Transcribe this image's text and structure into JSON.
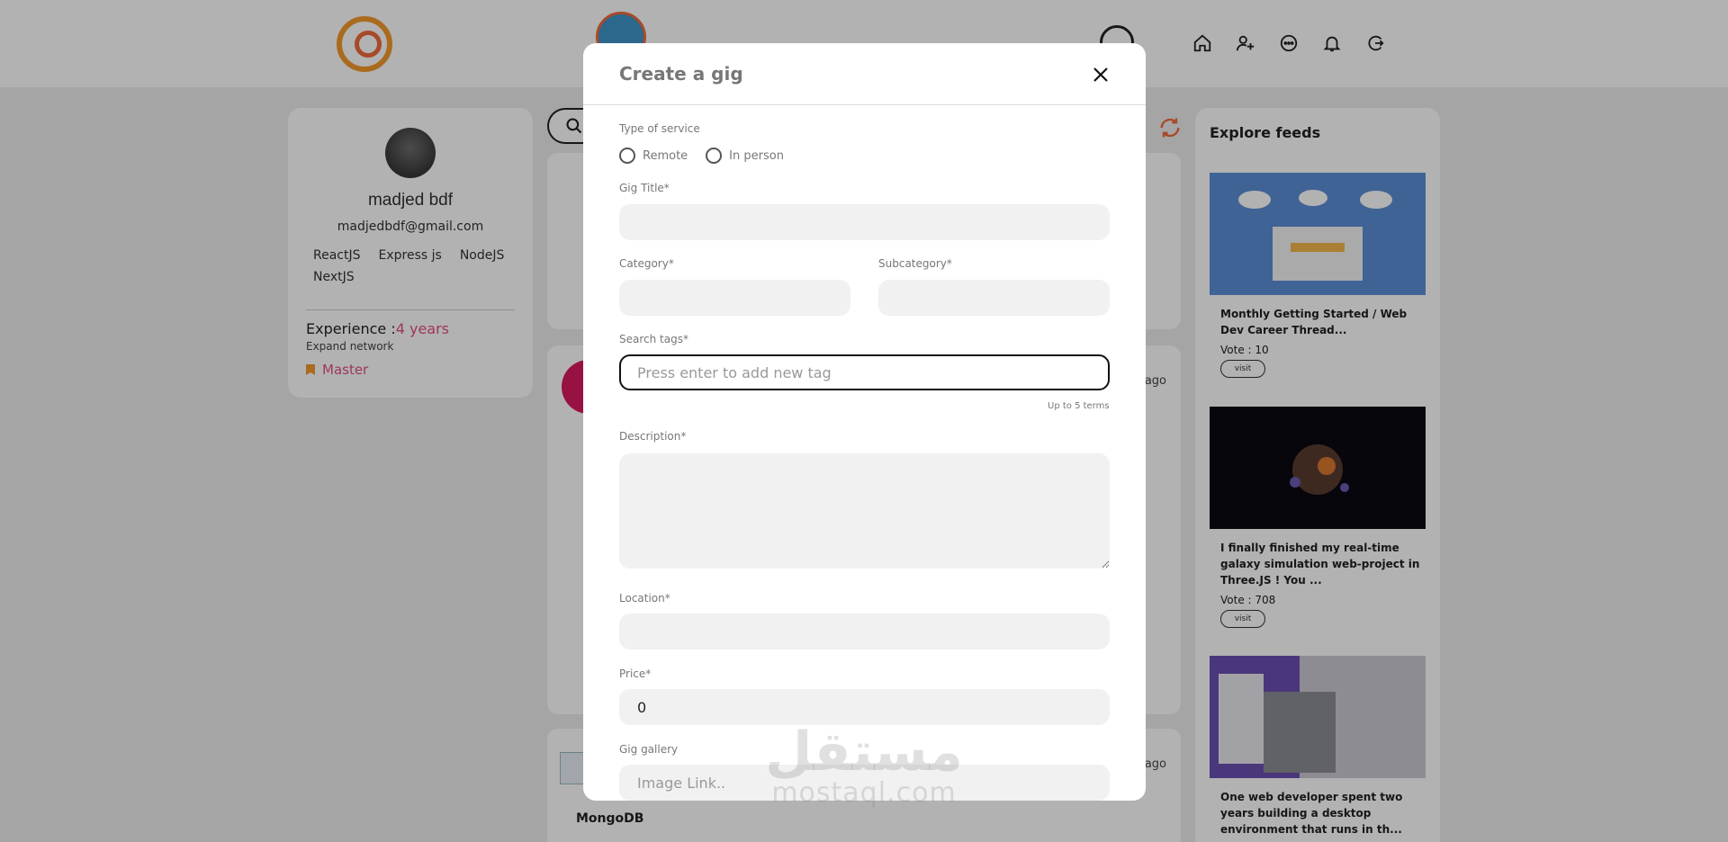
{
  "profile": {
    "name": "madjed bdf",
    "email": "madjedbdf@gmail.com",
    "skills": [
      "ReactJS",
      "Express js",
      "NodeJS",
      "NextJS"
    ],
    "experience_label": "Experience :",
    "experience_value": "4 years",
    "expand": "Expand network",
    "badge": "Master"
  },
  "feed": {
    "post_ago": "ago",
    "post2_title": "MongoDB"
  },
  "explore": {
    "title": "Explore feeds",
    "items": [
      {
        "title": "Monthly Getting Started / Web Dev Career Thread...",
        "vote": "Vote : 10",
        "visit": "visit"
      },
      {
        "title": "I finally finished my real-time galaxy simulation web-project in Three.JS ! You ...",
        "vote": "Vote : 708",
        "visit": "visit"
      },
      {
        "title": "One web developer spent two years building a desktop environment that runs in th...",
        "vote": "",
        "visit": ""
      }
    ]
  },
  "modal": {
    "title": "Create a gig",
    "service_label": "Type of service",
    "service_options": [
      "Remote",
      "In person"
    ],
    "gig_title_label": "Gig Title*",
    "category_label": "Category*",
    "subcategory_label": "Subcategory*",
    "tags_label": "Search tags*",
    "tags_placeholder": "Press enter to add new tag",
    "tags_hint": "Up to 5 terms",
    "description_label": "Description*",
    "location_label": "Location*",
    "price_label": "Price*",
    "price_value": "0",
    "gallery_label": "Gig gallery",
    "gallery_placeholder": "Image Link.."
  },
  "watermark": {
    "text": "mostaql.com"
  },
  "colors": {
    "accent_pink": "#e14e86",
    "brand_orange": "#f39a2c",
    "overlay": "rgba(0,0,0,0.3)"
  }
}
